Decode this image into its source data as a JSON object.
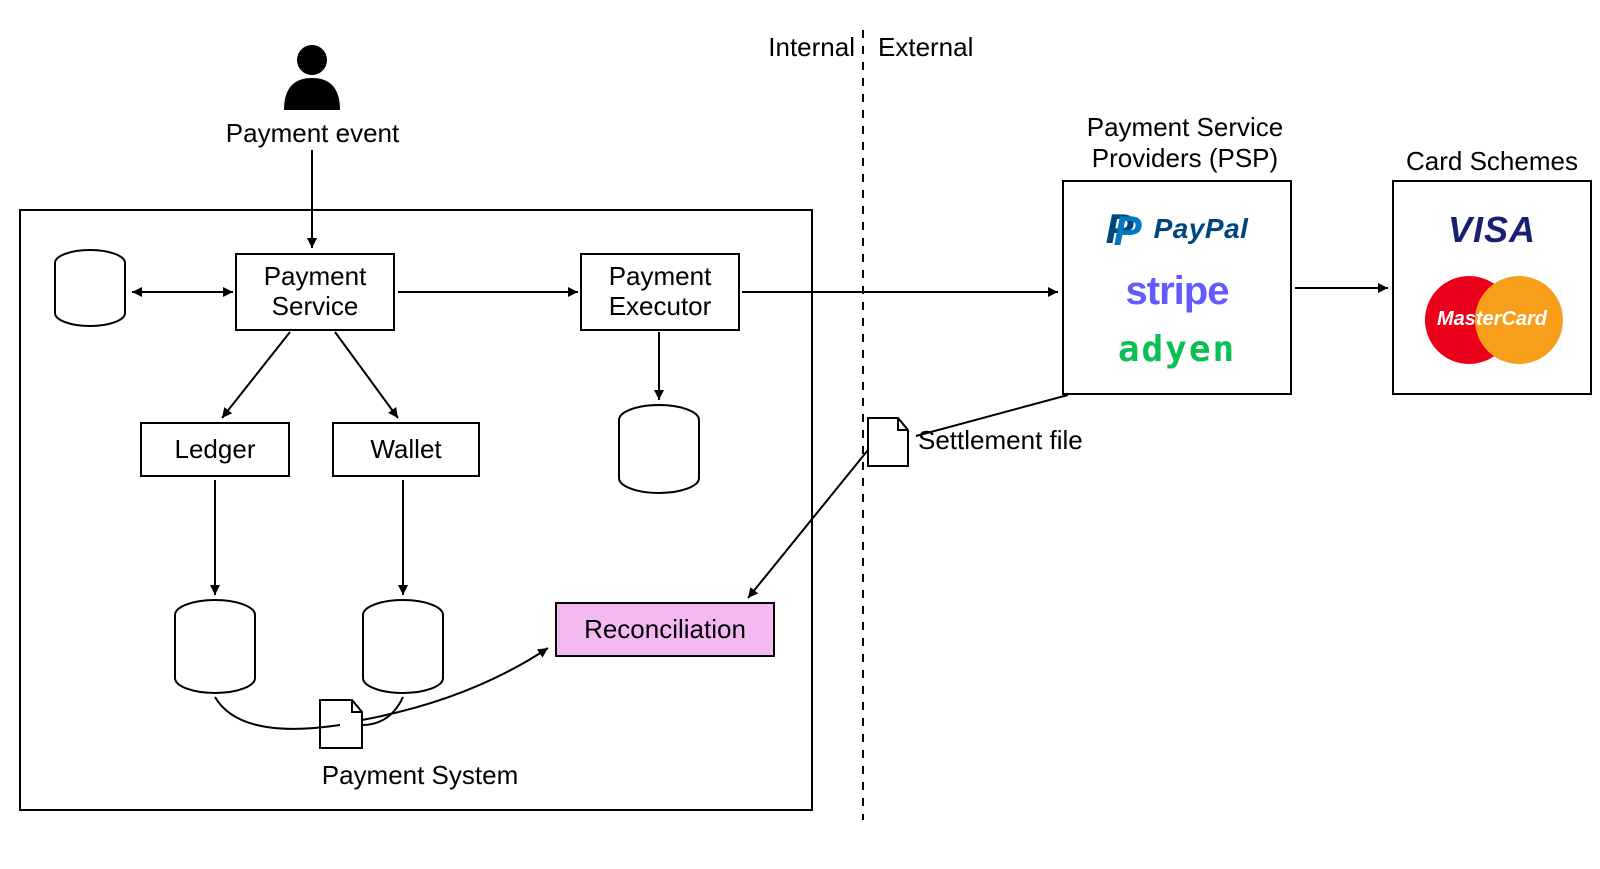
{
  "divider": {
    "internal": "Internal",
    "external": "External"
  },
  "actor": {
    "label": "Payment event"
  },
  "internal": {
    "payment_service": "Payment\nService",
    "payment_executor": "Payment\nExecutor",
    "ledger": "Ledger",
    "wallet": "Wallet",
    "reconciliation": "Reconciliation",
    "system_caption": "Payment System"
  },
  "settlement_file": "Settlement file",
  "psp": {
    "title": "Payment Service\nProviders (PSP)",
    "logos": {
      "paypal": "PayPal",
      "stripe": "stripe",
      "adyen": "adyen"
    }
  },
  "card_schemes": {
    "title": "Card Schemes",
    "visa": "VISA",
    "mastercard": "MasterCard"
  },
  "colors": {
    "reconciliation_fill": "#F4B9F0",
    "paypal_dark": "#00457C",
    "paypal_light": "#0079C1",
    "stripe": "#635BFF",
    "adyen": "#0ABF53",
    "visa": "#1A1F71",
    "mc_left": "#EB001B",
    "mc_right": "#F79E1B"
  }
}
